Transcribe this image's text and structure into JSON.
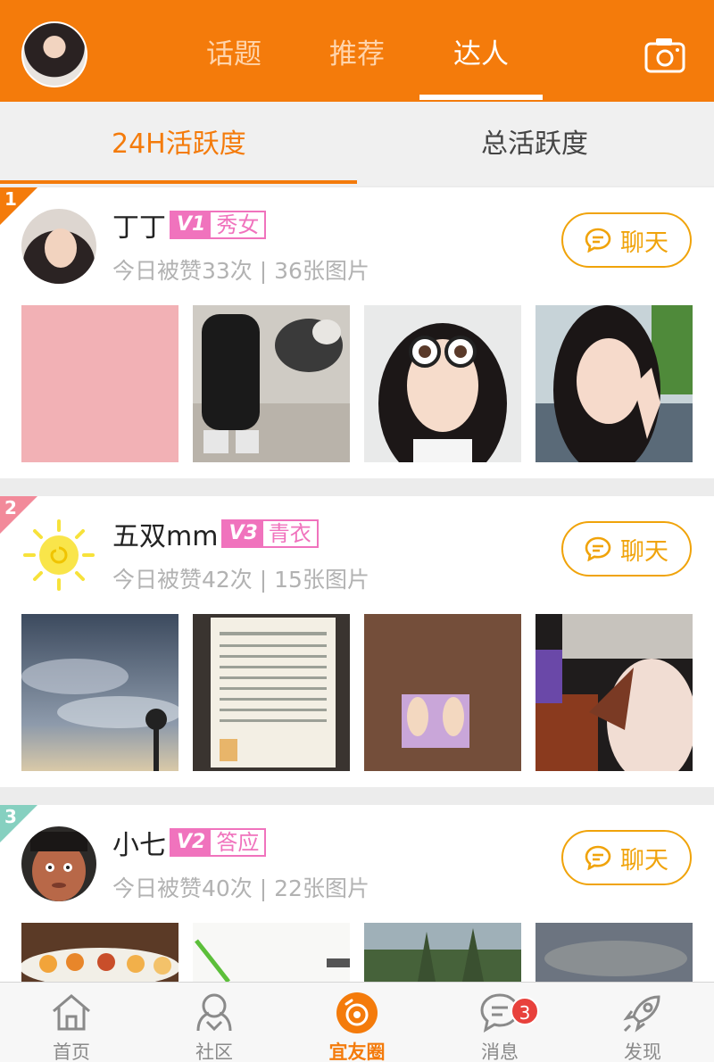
{
  "header": {
    "tabs": [
      {
        "label": "话题"
      },
      {
        "label": "推荐"
      },
      {
        "label": "达人"
      }
    ],
    "active_tab": "达人"
  },
  "subtabs": [
    {
      "label": "24H活跃度"
    },
    {
      "label": "总活跃度"
    }
  ],
  "users": [
    {
      "rank": "1",
      "name": "丁丁",
      "level": "V1",
      "title": "秀女",
      "stats": "今日被赞33次 | 36张图片",
      "chat": "聊天"
    },
    {
      "rank": "2",
      "name": "五双mm",
      "level": "V3",
      "title": "青衣",
      "stats": "今日被赞42次 | 15张图片",
      "chat": "聊天"
    },
    {
      "rank": "3",
      "name": "小七",
      "level": "V2",
      "title": "答应",
      "stats": "今日被赞40次 | 22张图片",
      "chat": "聊天"
    }
  ],
  "bottom_nav": [
    {
      "label": "首页",
      "icon": "home-icon"
    },
    {
      "label": "社区",
      "icon": "community-icon"
    },
    {
      "label": "宜友圈",
      "icon": "circle-icon"
    },
    {
      "label": "消息",
      "icon": "message-icon",
      "badge": "3"
    },
    {
      "label": "发现",
      "icon": "rocket-icon"
    }
  ],
  "colors": {
    "brand": "#f47b0b",
    "chat": "#f0a30a",
    "level": "#f073bd",
    "badge": "#e8413c"
  }
}
